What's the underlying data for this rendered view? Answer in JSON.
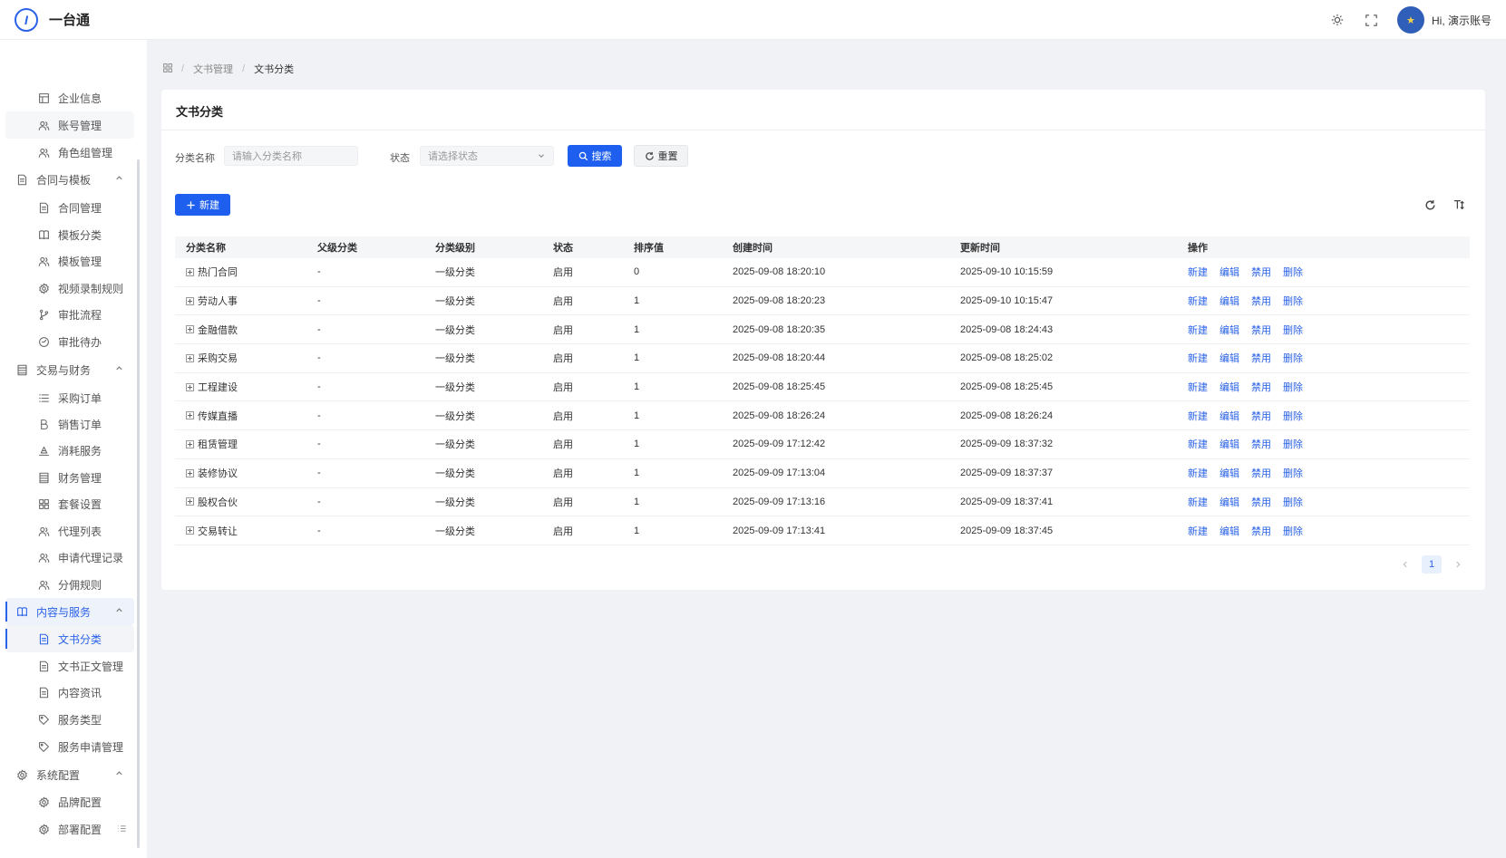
{
  "app": {
    "title": "一台通",
    "logo_text": "I",
    "greeting": "Hi, 演示账号",
    "avatar_glyph": "★"
  },
  "colors": {
    "primary": "#1f5ff0",
    "link": "#2a62e8",
    "background": "#f0f2f5"
  },
  "sidebar": {
    "items": [
      {
        "label": "企业信息",
        "icon": "table-icon",
        "kind": "child"
      },
      {
        "label": "账号管理",
        "icon": "users-icon",
        "kind": "child"
      },
      {
        "label": "角色组管理",
        "icon": "users-icon",
        "kind": "child"
      },
      {
        "label": "合同与模板",
        "icon": "document-icon",
        "kind": "group"
      },
      {
        "label": "合同管理",
        "icon": "document-icon",
        "kind": "child"
      },
      {
        "label": "模板分类",
        "icon": "book-icon",
        "kind": "child"
      },
      {
        "label": "模板管理",
        "icon": "users-icon",
        "kind": "child"
      },
      {
        "label": "视频录制规则",
        "icon": "gear-icon",
        "kind": "child"
      },
      {
        "label": "审批流程",
        "icon": "branch-icon",
        "kind": "child"
      },
      {
        "label": "审批待办",
        "icon": "clock-icon",
        "kind": "child"
      },
      {
        "label": "交易与财务",
        "icon": "ledger-icon",
        "kind": "group"
      },
      {
        "label": "采购订单",
        "icon": "list-icon",
        "kind": "child"
      },
      {
        "label": "销售订单",
        "icon": "letter-b-icon",
        "kind": "child"
      },
      {
        "label": "消耗服务",
        "icon": "consume-icon",
        "kind": "child"
      },
      {
        "label": "财务管理",
        "icon": "ledger-icon",
        "kind": "child"
      },
      {
        "label": "套餐设置",
        "icon": "grid-icon",
        "kind": "child"
      },
      {
        "label": "代理列表",
        "icon": "users-icon",
        "kind": "child"
      },
      {
        "label": "申请代理记录",
        "icon": "users-icon",
        "kind": "child"
      },
      {
        "label": "分佣规则",
        "icon": "users-icon",
        "kind": "child"
      },
      {
        "label": "内容与服务",
        "icon": "book-icon",
        "kind": "group"
      },
      {
        "label": "文书分类",
        "icon": "document-icon",
        "kind": "child"
      },
      {
        "label": "文书正文管理",
        "icon": "document-icon",
        "kind": "child"
      },
      {
        "label": "内容资讯",
        "icon": "document-icon",
        "kind": "child"
      },
      {
        "label": "服务类型",
        "icon": "tag-icon",
        "kind": "child"
      },
      {
        "label": "服务申请管理",
        "icon": "tag-icon",
        "kind": "child"
      },
      {
        "label": "系统配置",
        "icon": "gear-icon",
        "kind": "group"
      },
      {
        "label": "品牌配置",
        "icon": "gear-icon",
        "kind": "child"
      },
      {
        "label": "部署配置",
        "icon": "gear-icon",
        "kind": "child"
      }
    ]
  },
  "breadcrumb": {
    "home_icon": "grid-icon",
    "parent": "文书管理",
    "current": "文书分类",
    "separator": "/"
  },
  "card": {
    "title": "文书分类"
  },
  "filters": {
    "name_label": "分类名称",
    "name_placeholder": "请输入分类名称",
    "status_label": "状态",
    "status_placeholder": "请选择状态",
    "search_label": "搜索",
    "reset_label": "重置"
  },
  "toolbar": {
    "new_label": "新建"
  },
  "table": {
    "headers": {
      "name": "分类名称",
      "parent": "父级分类",
      "level": "分类级别",
      "status": "状态",
      "sort": "排序值",
      "created": "创建时间",
      "updated": "更新时间",
      "ops": "操作"
    },
    "ops": [
      "新建",
      "编辑",
      "禁用",
      "删除"
    ],
    "rows": [
      {
        "name": "热门合同",
        "parent": "-",
        "level": "一级分类",
        "status": "启用",
        "sort": "0",
        "created": "2025-09-08 18:20:10",
        "updated": "2025-09-10 10:15:59"
      },
      {
        "name": "劳动人事",
        "parent": "-",
        "level": "一级分类",
        "status": "启用",
        "sort": "1",
        "created": "2025-09-08 18:20:23",
        "updated": "2025-09-10 10:15:47"
      },
      {
        "name": "金融借款",
        "parent": "-",
        "level": "一级分类",
        "status": "启用",
        "sort": "1",
        "created": "2025-09-08 18:20:35",
        "updated": "2025-09-08 18:24:43"
      },
      {
        "name": "采购交易",
        "parent": "-",
        "level": "一级分类",
        "status": "启用",
        "sort": "1",
        "created": "2025-09-08 18:20:44",
        "updated": "2025-09-08 18:25:02"
      },
      {
        "name": "工程建设",
        "parent": "-",
        "level": "一级分类",
        "status": "启用",
        "sort": "1",
        "created": "2025-09-08 18:25:45",
        "updated": "2025-09-08 18:25:45"
      },
      {
        "name": "传媒直播",
        "parent": "-",
        "level": "一级分类",
        "status": "启用",
        "sort": "1",
        "created": "2025-09-08 18:26:24",
        "updated": "2025-09-08 18:26:24"
      },
      {
        "name": "租赁管理",
        "parent": "-",
        "level": "一级分类",
        "status": "启用",
        "sort": "1",
        "created": "2025-09-09 17:12:42",
        "updated": "2025-09-09 18:37:32"
      },
      {
        "name": "装修协议",
        "parent": "-",
        "level": "一级分类",
        "status": "启用",
        "sort": "1",
        "created": "2025-09-09 17:13:04",
        "updated": "2025-09-09 18:37:37"
      },
      {
        "name": "股权合伙",
        "parent": "-",
        "level": "一级分类",
        "status": "启用",
        "sort": "1",
        "created": "2025-09-09 17:13:16",
        "updated": "2025-09-09 18:37:41"
      },
      {
        "name": "交易转让",
        "parent": "-",
        "level": "一级分类",
        "status": "启用",
        "sort": "1",
        "created": "2025-09-09 17:13:41",
        "updated": "2025-09-09 18:37:45"
      }
    ]
  },
  "pagination": {
    "current_page": "1"
  }
}
